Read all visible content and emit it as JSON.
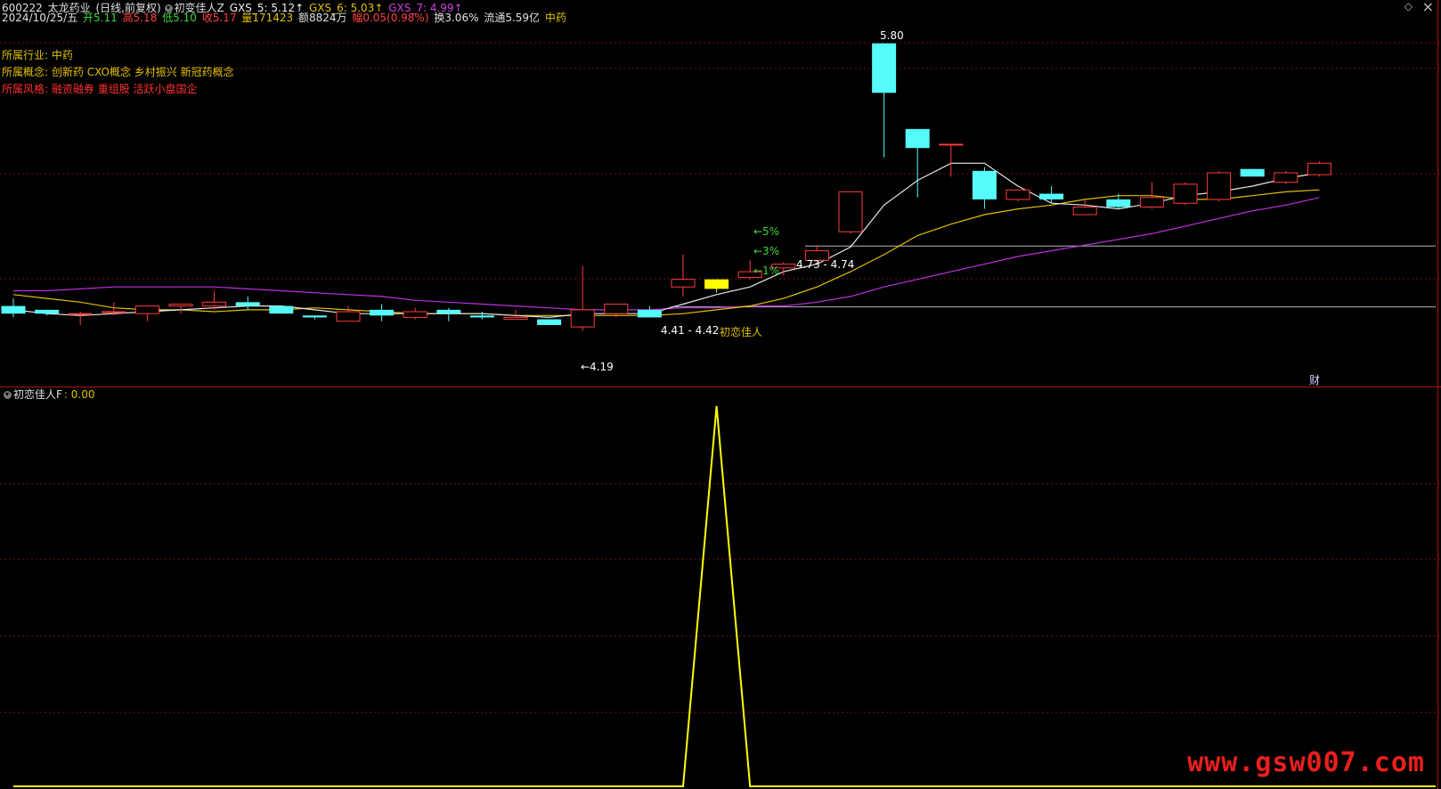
{
  "header": {
    "code": "600222",
    "name": "太龙药业",
    "mode": "(日线,前复权)",
    "indicator": "初变佳人Z",
    "gxs5": "GXS_5: 5.12↑",
    "gxs6": "GXS_6: 5.03↑",
    "gxs7": "GXS_7: 4.99↑"
  },
  "quote": {
    "date": "2024/10/25/五",
    "open": "开5.11",
    "high": "高5.18",
    "low": "低5.10",
    "close": "收5.17",
    "volume": "量171423",
    "amount": "额8824万",
    "change": "幅0.05(0.98%)",
    "turnover": "换3.06%",
    "float_cap": "流通5.59亿",
    "sector": "中药"
  },
  "info": {
    "industry_label": "所属行业:",
    "industry": "中药",
    "concept_label": "所属概念:",
    "concepts": "创新药 CXO概念 乡村振兴 新冠药概念",
    "style_label": "所属风格:",
    "styles": "融资融券 重组股 活跃小盘国企"
  },
  "annotations": {
    "peak": "5.80",
    "low": "←4.19",
    "band_upper": "4.73 - 4.74",
    "band_lower": "4.41 - 4.42",
    "signal": "初恋佳人",
    "pct5": "←5%",
    "pct3": "←3%",
    "pct1": "←1%",
    "fin": "财"
  },
  "sub": {
    "title": "初恋佳人F",
    "value": ": 0.00"
  },
  "watermark": "www.gsw007.com",
  "colors": {
    "up": "#ff3b3b",
    "down": "#54fcfc",
    "ma5": "#e8e8e8",
    "ma10": "#e0c000",
    "ma20": "#c030e0",
    "signal": "#ffff00",
    "grid": "#7a1010"
  },
  "chart_data": {
    "type": "candlestick",
    "price_ylim": [
      4.1,
      5.85
    ],
    "candles": [
      {
        "o": 4.42,
        "h": 4.46,
        "l": 4.36,
        "c": 4.38
      },
      {
        "o": 4.4,
        "h": 4.4,
        "l": 4.37,
        "c": 4.38
      },
      {
        "o": 4.38,
        "h": 4.39,
        "l": 4.32,
        "c": 4.38
      },
      {
        "o": 4.39,
        "h": 4.44,
        "l": 4.37,
        "c": 4.39
      },
      {
        "o": 4.38,
        "h": 4.42,
        "l": 4.34,
        "c": 4.42
      },
      {
        "o": 4.42,
        "h": 4.42,
        "l": 4.38,
        "c": 4.43
      },
      {
        "o": 4.42,
        "h": 4.5,
        "l": 4.4,
        "c": 4.44
      },
      {
        "o": 4.44,
        "h": 4.47,
        "l": 4.4,
        "c": 4.42
      },
      {
        "o": 4.42,
        "h": 4.41,
        "l": 4.38,
        "c": 4.38
      },
      {
        "o": 4.37,
        "h": 4.37,
        "l": 4.35,
        "c": 4.36
      },
      {
        "o": 4.34,
        "h": 4.42,
        "l": 4.34,
        "c": 4.39
      },
      {
        "o": 4.4,
        "h": 4.43,
        "l": 4.34,
        "c": 4.37
      },
      {
        "o": 4.36,
        "h": 4.41,
        "l": 4.35,
        "c": 4.39
      },
      {
        "o": 4.4,
        "h": 4.41,
        "l": 4.34,
        "c": 4.38
      },
      {
        "o": 4.37,
        "h": 4.39,
        "l": 4.35,
        "c": 4.36
      },
      {
        "o": 4.35,
        "h": 4.4,
        "l": 4.35,
        "c": 4.36
      },
      {
        "o": 4.35,
        "h": 4.35,
        "l": 4.32,
        "c": 4.32
      },
      {
        "o": 4.31,
        "h": 4.63,
        "l": 4.29,
        "c": 4.4
      },
      {
        "o": 4.38,
        "h": 4.42,
        "l": 4.36,
        "c": 4.43
      },
      {
        "o": 4.4,
        "h": 4.42,
        "l": 4.36,
        "c": 4.36
      },
      {
        "o": 4.52,
        "h": 4.69,
        "l": 4.47,
        "c": 4.56
      },
      {
        "o": 4.51,
        "h": 4.56,
        "l": 4.49,
        "c": 4.56
      },
      {
        "o": 4.57,
        "h": 4.66,
        "l": 4.56,
        "c": 4.6
      },
      {
        "o": 4.62,
        "h": 4.65,
        "l": 4.58,
        "c": 4.64
      },
      {
        "o": 4.66,
        "h": 4.74,
        "l": 4.64,
        "c": 4.71
      },
      {
        "o": 4.81,
        "h": 5.02,
        "l": 4.8,
        "c": 5.02
      },
      {
        "o": 5.8,
        "h": 5.8,
        "l": 5.2,
        "c": 5.54
      },
      {
        "o": 5.35,
        "h": 5.35,
        "l": 4.99,
        "c": 5.25
      },
      {
        "o": 5.27,
        "h": 5.18,
        "l": 5.1,
        "c": 5.27
      },
      {
        "o": 5.13,
        "h": 5.15,
        "l": 4.93,
        "c": 4.98
      },
      {
        "o": 4.98,
        "h": 5.0,
        "l": 4.97,
        "c": 5.03
      },
      {
        "o": 5.01,
        "h": 5.05,
        "l": 4.96,
        "c": 4.98
      },
      {
        "o": 4.9,
        "h": 4.98,
        "l": 4.9,
        "c": 4.94
      },
      {
        "o": 4.98,
        "h": 5.01,
        "l": 4.93,
        "c": 4.94
      },
      {
        "o": 4.94,
        "h": 5.07,
        "l": 4.93,
        "c": 4.99
      },
      {
        "o": 4.96,
        "h": 5.07,
        "l": 4.95,
        "c": 5.06
      },
      {
        "o": 4.98,
        "h": 5.13,
        "l": 4.97,
        "c": 5.12
      },
      {
        "o": 5.14,
        "h": 5.14,
        "l": 5.1,
        "c": 5.1
      },
      {
        "o": 5.07,
        "h": 5.13,
        "l": 5.06,
        "c": 5.12
      },
      {
        "o": 5.11,
        "h": 5.18,
        "l": 5.1,
        "c": 5.17
      }
    ],
    "ma5": [
      4.4,
      4.38,
      4.37,
      4.38,
      4.39,
      4.4,
      4.41,
      4.42,
      4.42,
      4.4,
      4.38,
      4.38,
      4.38,
      4.38,
      4.38,
      4.37,
      4.36,
      4.38,
      4.38,
      4.38,
      4.43,
      4.48,
      4.52,
      4.6,
      4.64,
      4.73,
      4.95,
      5.08,
      5.17,
      5.17,
      5.05,
      4.96,
      4.95,
      4.93,
      4.96,
      5.0,
      5.02,
      5.05,
      5.09,
      5.12
    ],
    "ma10": [
      4.48,
      4.46,
      4.44,
      4.41,
      4.4,
      4.4,
      4.39,
      4.4,
      4.4,
      4.41,
      4.4,
      4.39,
      4.38,
      4.38,
      4.38,
      4.37,
      4.37,
      4.37,
      4.37,
      4.37,
      4.38,
      4.4,
      4.42,
      4.46,
      4.52,
      4.6,
      4.69,
      4.79,
      4.85,
      4.9,
      4.93,
      4.95,
      4.98,
      5.0,
      5.0,
      4.98,
      4.98,
      5.0,
      5.02,
      5.03
    ],
    "ma20": [
      4.5,
      4.5,
      4.51,
      4.52,
      4.52,
      4.52,
      4.52,
      4.51,
      4.5,
      4.49,
      4.48,
      4.47,
      4.45,
      4.44,
      4.43,
      4.42,
      4.41,
      4.4,
      4.4,
      4.4,
      4.41,
      4.41,
      4.42,
      4.42,
      4.44,
      4.47,
      4.52,
      4.56,
      4.6,
      4.64,
      4.68,
      4.71,
      4.74,
      4.77,
      4.8,
      4.84,
      4.88,
      4.92,
      4.95,
      4.99
    ],
    "hlines": [
      4.735,
      4.415
    ],
    "signal_ylim": [
      0,
      1
    ],
    "signal": [
      0,
      0,
      0,
      0,
      0,
      0,
      0,
      0,
      0,
      0,
      0,
      0,
      0,
      0,
      0,
      0,
      0,
      0,
      0,
      0,
      0,
      1,
      0,
      0,
      0,
      0,
      0,
      0,
      0,
      0,
      0,
      0,
      0,
      0,
      0,
      0,
      0,
      0,
      0,
      0
    ]
  }
}
